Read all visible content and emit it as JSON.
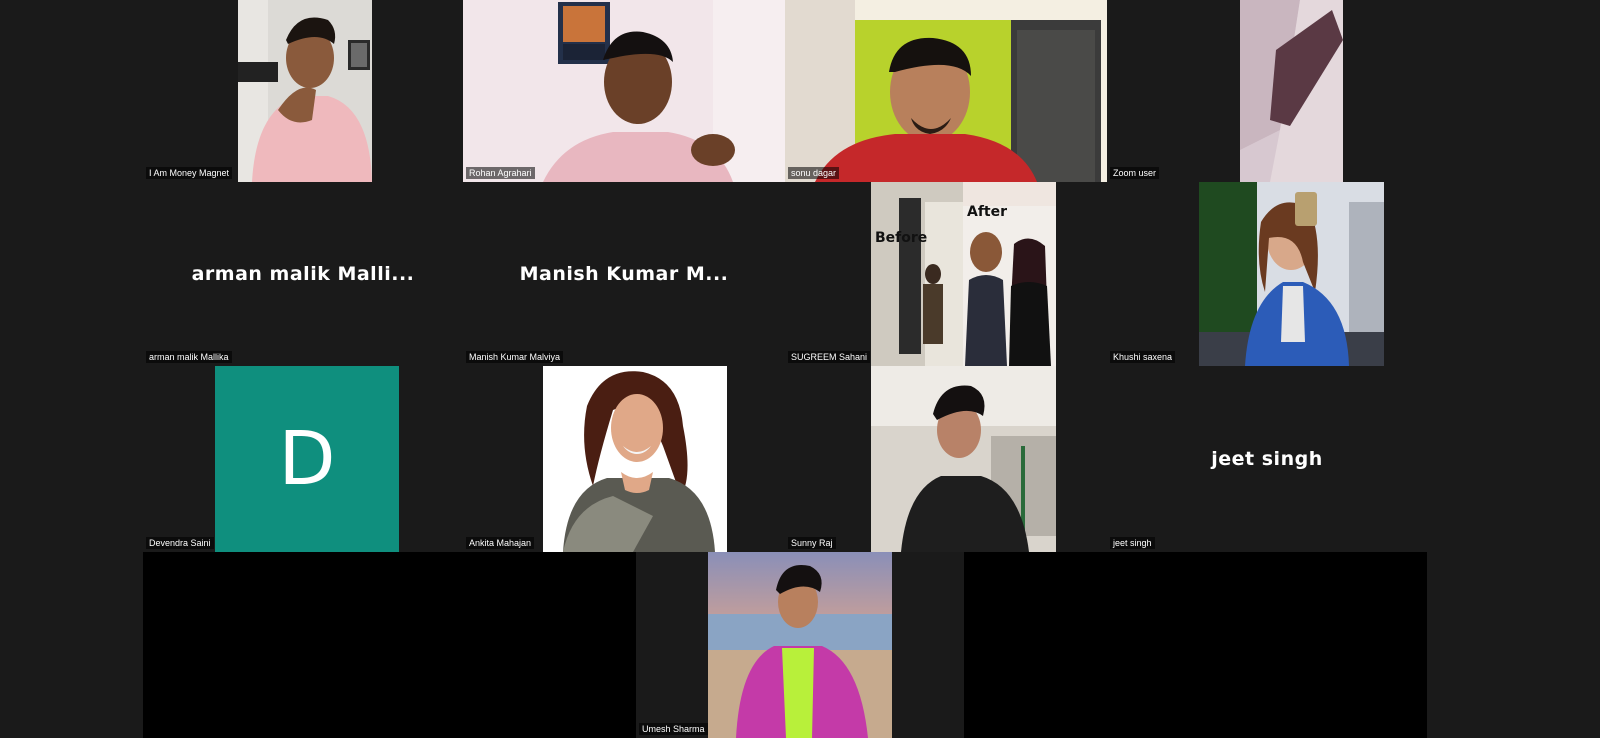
{
  "participants": [
    {
      "name": "I Am Money Magnet",
      "type": "video",
      "scene": "man-pink-shirt"
    },
    {
      "name": "Rohan Agrahari",
      "type": "video",
      "scene": "man-talking-poster"
    },
    {
      "name": "sonu dagar",
      "type": "video",
      "scene": "man-red-shirt-green-wall"
    },
    {
      "name": "Zoom user",
      "type": "video",
      "scene": "wall-corner"
    },
    {
      "name": "arman malik Mallika",
      "type": "name",
      "display": "arman malik Malli..."
    },
    {
      "name": "Manish Kumar Malviya",
      "type": "name",
      "display": "Manish Kumar M..."
    },
    {
      "name": "SUGREEM Sahani",
      "type": "video",
      "scene": "before-after",
      "before_text": "Before",
      "after_text": "After"
    },
    {
      "name": "Khushi saxena",
      "type": "video",
      "scene": "woman-selfie"
    },
    {
      "name": "Devendra Saini",
      "type": "avatar",
      "initial": "D",
      "color": "#0f8f7e"
    },
    {
      "name": "Ankita Mahajan",
      "type": "video",
      "scene": "woman-saree"
    },
    {
      "name": "Sunny Raj",
      "type": "video",
      "scene": "man-black-shirt"
    },
    {
      "name": "jeet singh",
      "type": "name",
      "display": "jeet singh"
    },
    {
      "name": "Umesh Sharma",
      "type": "video",
      "scene": "man-pink-suit-beach"
    }
  ]
}
